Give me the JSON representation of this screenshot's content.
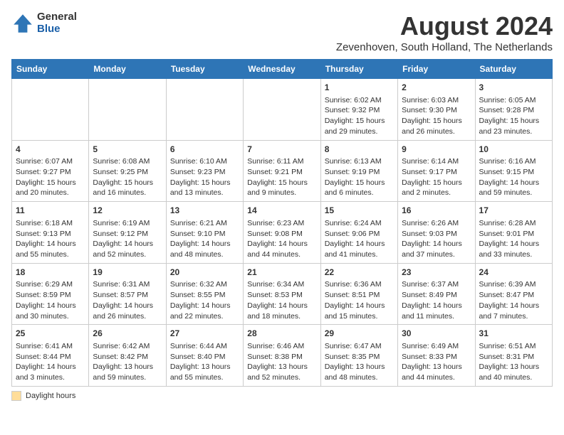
{
  "logo": {
    "general": "General",
    "blue": "Blue"
  },
  "title": "August 2024",
  "subtitle": "Zevenhoven, South Holland, The Netherlands",
  "days_header": [
    "Sunday",
    "Monday",
    "Tuesday",
    "Wednesday",
    "Thursday",
    "Friday",
    "Saturday"
  ],
  "footer": {
    "daylight_label": "Daylight hours"
  },
  "weeks": [
    {
      "days": [
        {
          "number": "",
          "info": ""
        },
        {
          "number": "",
          "info": ""
        },
        {
          "number": "",
          "info": ""
        },
        {
          "number": "",
          "info": ""
        },
        {
          "number": "1",
          "info": "Sunrise: 6:02 AM\nSunset: 9:32 PM\nDaylight: 15 hours\nand 29 minutes."
        },
        {
          "number": "2",
          "info": "Sunrise: 6:03 AM\nSunset: 9:30 PM\nDaylight: 15 hours\nand 26 minutes."
        },
        {
          "number": "3",
          "info": "Sunrise: 6:05 AM\nSunset: 9:28 PM\nDaylight: 15 hours\nand 23 minutes."
        }
      ]
    },
    {
      "days": [
        {
          "number": "4",
          "info": "Sunrise: 6:07 AM\nSunset: 9:27 PM\nDaylight: 15 hours\nand 20 minutes."
        },
        {
          "number": "5",
          "info": "Sunrise: 6:08 AM\nSunset: 9:25 PM\nDaylight: 15 hours\nand 16 minutes."
        },
        {
          "number": "6",
          "info": "Sunrise: 6:10 AM\nSunset: 9:23 PM\nDaylight: 15 hours\nand 13 minutes."
        },
        {
          "number": "7",
          "info": "Sunrise: 6:11 AM\nSunset: 9:21 PM\nDaylight: 15 hours\nand 9 minutes."
        },
        {
          "number": "8",
          "info": "Sunrise: 6:13 AM\nSunset: 9:19 PM\nDaylight: 15 hours\nand 6 minutes."
        },
        {
          "number": "9",
          "info": "Sunrise: 6:14 AM\nSunset: 9:17 PM\nDaylight: 15 hours\nand 2 minutes."
        },
        {
          "number": "10",
          "info": "Sunrise: 6:16 AM\nSunset: 9:15 PM\nDaylight: 14 hours\nand 59 minutes."
        }
      ]
    },
    {
      "days": [
        {
          "number": "11",
          "info": "Sunrise: 6:18 AM\nSunset: 9:13 PM\nDaylight: 14 hours\nand 55 minutes."
        },
        {
          "number": "12",
          "info": "Sunrise: 6:19 AM\nSunset: 9:12 PM\nDaylight: 14 hours\nand 52 minutes."
        },
        {
          "number": "13",
          "info": "Sunrise: 6:21 AM\nSunset: 9:10 PM\nDaylight: 14 hours\nand 48 minutes."
        },
        {
          "number": "14",
          "info": "Sunrise: 6:23 AM\nSunset: 9:08 PM\nDaylight: 14 hours\nand 44 minutes."
        },
        {
          "number": "15",
          "info": "Sunrise: 6:24 AM\nSunset: 9:06 PM\nDaylight: 14 hours\nand 41 minutes."
        },
        {
          "number": "16",
          "info": "Sunrise: 6:26 AM\nSunset: 9:03 PM\nDaylight: 14 hours\nand 37 minutes."
        },
        {
          "number": "17",
          "info": "Sunrise: 6:28 AM\nSunset: 9:01 PM\nDaylight: 14 hours\nand 33 minutes."
        }
      ]
    },
    {
      "days": [
        {
          "number": "18",
          "info": "Sunrise: 6:29 AM\nSunset: 8:59 PM\nDaylight: 14 hours\nand 30 minutes."
        },
        {
          "number": "19",
          "info": "Sunrise: 6:31 AM\nSunset: 8:57 PM\nDaylight: 14 hours\nand 26 minutes."
        },
        {
          "number": "20",
          "info": "Sunrise: 6:32 AM\nSunset: 8:55 PM\nDaylight: 14 hours\nand 22 minutes."
        },
        {
          "number": "21",
          "info": "Sunrise: 6:34 AM\nSunset: 8:53 PM\nDaylight: 14 hours\nand 18 minutes."
        },
        {
          "number": "22",
          "info": "Sunrise: 6:36 AM\nSunset: 8:51 PM\nDaylight: 14 hours\nand 15 minutes."
        },
        {
          "number": "23",
          "info": "Sunrise: 6:37 AM\nSunset: 8:49 PM\nDaylight: 14 hours\nand 11 minutes."
        },
        {
          "number": "24",
          "info": "Sunrise: 6:39 AM\nSunset: 8:47 PM\nDaylight: 14 hours\nand 7 minutes."
        }
      ]
    },
    {
      "days": [
        {
          "number": "25",
          "info": "Sunrise: 6:41 AM\nSunset: 8:44 PM\nDaylight: 14 hours\nand 3 minutes."
        },
        {
          "number": "26",
          "info": "Sunrise: 6:42 AM\nSunset: 8:42 PM\nDaylight: 13 hours\nand 59 minutes."
        },
        {
          "number": "27",
          "info": "Sunrise: 6:44 AM\nSunset: 8:40 PM\nDaylight: 13 hours\nand 55 minutes."
        },
        {
          "number": "28",
          "info": "Sunrise: 6:46 AM\nSunset: 8:38 PM\nDaylight: 13 hours\nand 52 minutes."
        },
        {
          "number": "29",
          "info": "Sunrise: 6:47 AM\nSunset: 8:35 PM\nDaylight: 13 hours\nand 48 minutes."
        },
        {
          "number": "30",
          "info": "Sunrise: 6:49 AM\nSunset: 8:33 PM\nDaylight: 13 hours\nand 44 minutes."
        },
        {
          "number": "31",
          "info": "Sunrise: 6:51 AM\nSunset: 8:31 PM\nDaylight: 13 hours\nand 40 minutes."
        }
      ]
    }
  ]
}
